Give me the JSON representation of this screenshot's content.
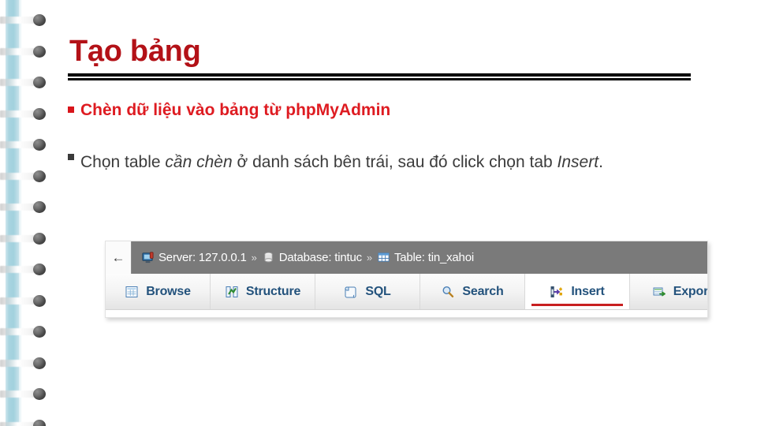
{
  "slide": {
    "title": "Tạo bảng",
    "title_color": "#B31117",
    "background": "#ffffff"
  },
  "bullets": [
    {
      "marker": "square-bullet-red",
      "marker_color": "#D8151B",
      "text": "Chèn dữ liệu vào bảng từ phpMyAdmin",
      "emphasis": "bold-red"
    },
    {
      "marker": "square-bullet-dark",
      "marker_color": "#3a3a3a",
      "line1_plain_a": "Chọn table ",
      "line1_italic_a": "cần chèn",
      "line1_plain_b": " ở danh sách bên trái, sau đó click chọn",
      "line2_plain_a": "tab ",
      "line2_italic_a": "Insert",
      "line2_plain_b": ".",
      "full_text": "Chọn table cần chèn ở danh sách bên trái, sau đó click chọn tab Insert."
    }
  ],
  "screenshot": {
    "app": "phpMyAdmin",
    "back_button_icon": "back-arrow-icon",
    "back_button_glyph": "←",
    "breadcrumb": {
      "separator": "»",
      "items": [
        {
          "icon": "server-icon",
          "label": "Server: 127.0.0.1"
        },
        {
          "icon": "database-icon",
          "label": "Database: tintuc"
        },
        {
          "icon": "table-icon",
          "label": "Table: tin_xahoi"
        }
      ]
    },
    "tabs": [
      {
        "icon": "browse-grid-icon",
        "label": "Browse",
        "active": false
      },
      {
        "icon": "structure-icon",
        "label": "Structure",
        "active": false
      },
      {
        "icon": "sql-scroll-icon",
        "label": "SQL",
        "active": false
      },
      {
        "icon": "search-magnifier-icon",
        "label": "Search",
        "active": false
      },
      {
        "icon": "insert-row-icon",
        "label": "Insert",
        "active": true
      },
      {
        "icon": "export-arrow-icon",
        "label": "Export",
        "active": false
      }
    ],
    "active_tab_underline_color": "#c81f20",
    "tab_label_color": "#23527c",
    "breadcrumb_bar_color": "#7a7a7a"
  },
  "decoration": {
    "binding_strip_color": "#a8d4e0",
    "ring_count": 14,
    "title_rule_color": "#000000"
  }
}
